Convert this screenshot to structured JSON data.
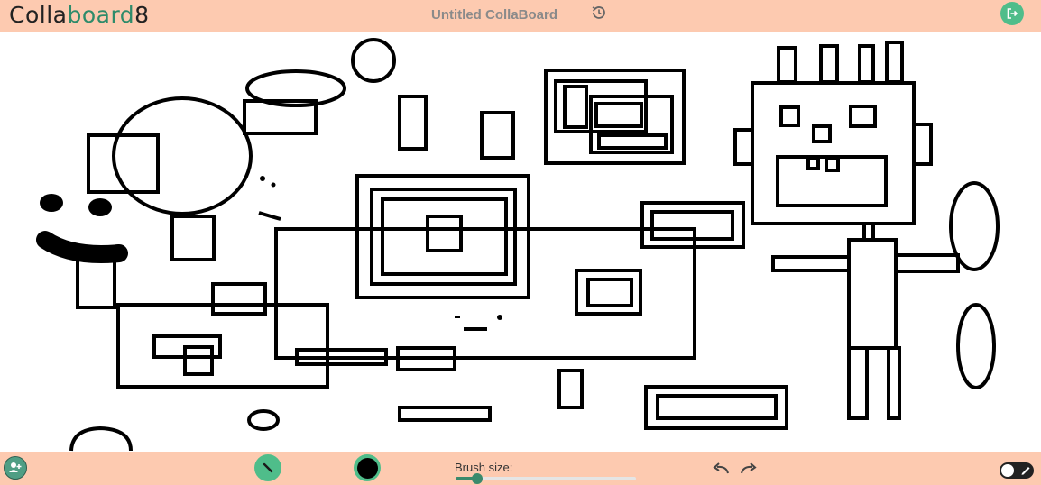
{
  "header": {
    "logo_part1": "Colla",
    "logo_part2": "board",
    "logo_part3": "8",
    "title": "Untitled CollaBoard",
    "history_icon": "history-icon",
    "exit_icon": "logout-icon"
  },
  "toolbar": {
    "add_user_icon": "add-user-icon",
    "tool_icon": "brush-icon",
    "brush_color": "#000000",
    "brush_size_label": "Brush size:",
    "brush_size_fraction": 0.12,
    "undo_icon": "undo-icon",
    "redo_icon": "redo-icon",
    "mode_toggle_icon": "pen-toggle-icon"
  },
  "colors": {
    "bar": "#fdcab0",
    "accent": "#4fbd8a",
    "stroke": "#000000"
  }
}
